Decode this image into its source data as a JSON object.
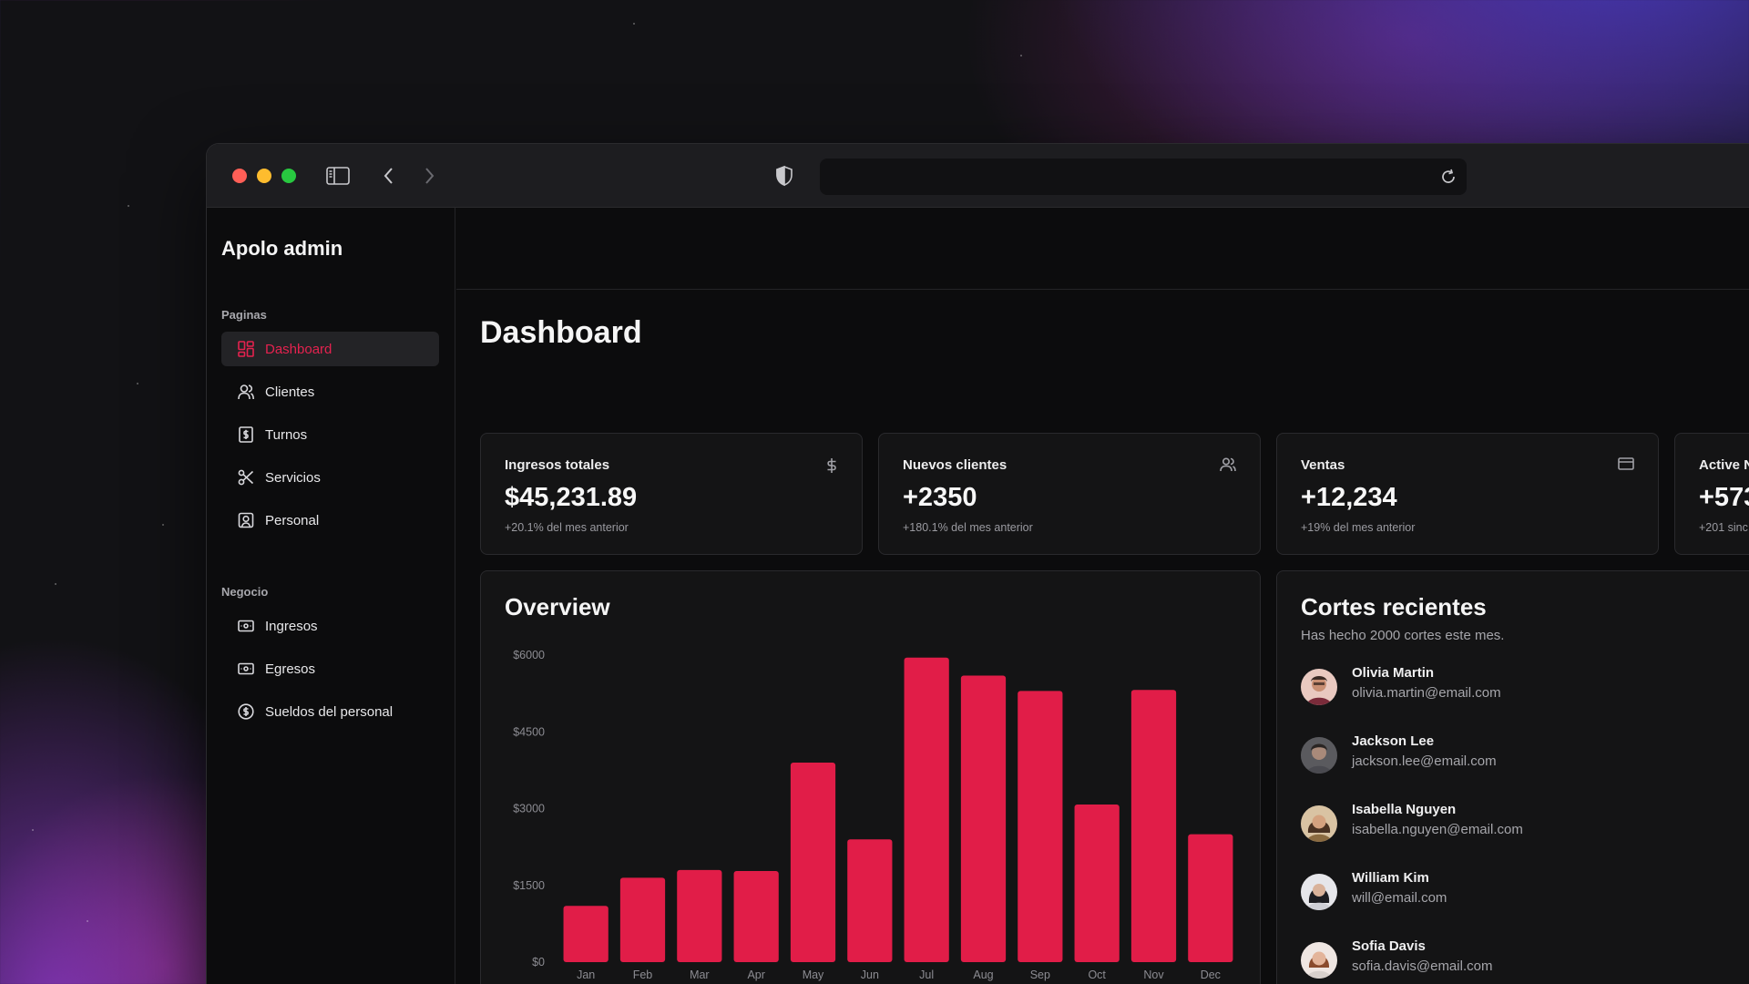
{
  "app": {
    "title": "Apolo admin"
  },
  "sidebar": {
    "sections": [
      {
        "label": "Paginas",
        "items": [
          {
            "label": "Dashboard",
            "icon": "dashboard-icon",
            "active": true
          },
          {
            "label": "Clientes",
            "icon": "users-icon"
          },
          {
            "label": "Turnos",
            "icon": "receipt-icon"
          },
          {
            "label": "Servicios",
            "icon": "scissors-icon"
          },
          {
            "label": "Personal",
            "icon": "contact-icon"
          }
        ]
      },
      {
        "label": "Negocio",
        "items": [
          {
            "label": "Ingresos",
            "icon": "banknote-in-icon"
          },
          {
            "label": "Egresos",
            "icon": "banknote-out-icon"
          },
          {
            "label": "Sueldos del personal",
            "icon": "dollar-circle-icon"
          }
        ]
      }
    ]
  },
  "page": {
    "title": "Dashboard"
  },
  "stats": [
    {
      "label": "Ingresos totales",
      "value": "$45,231.89",
      "sub": "+20.1% del mes anterior",
      "icon": "dollar-icon"
    },
    {
      "label": "Nuevos clientes",
      "value": "+2350",
      "sub": "+180.1% del mes anterior",
      "icon": "users-icon"
    },
    {
      "label": "Ventas",
      "value": "+12,234",
      "sub": "+19% del mes anterior",
      "icon": "credit-card-icon"
    },
    {
      "label": "Active N",
      "value": "+573",
      "sub": "+201 sinc",
      "icon": ""
    }
  ],
  "overview": {
    "title": "Overview"
  },
  "chart_data": {
    "type": "bar",
    "title": "Overview",
    "categories": [
      "Jan",
      "Feb",
      "Mar",
      "Apr",
      "May",
      "Jun",
      "Jul",
      "Aug",
      "Sep",
      "Oct",
      "Nov",
      "Dec"
    ],
    "values": [
      1100,
      1650,
      1800,
      1780,
      3900,
      2400,
      5950,
      5600,
      5300,
      3080,
      5320,
      2500
    ],
    "ylim": [
      0,
      6000
    ],
    "yticks": [
      0,
      1500,
      3000,
      4500,
      6000
    ],
    "ytick_labels": [
      "$0",
      "$1500",
      "$3000",
      "$4500",
      "$6000"
    ],
    "xlabel": "",
    "ylabel": "",
    "grid": false,
    "bar_color": "#e11d48"
  },
  "recent": {
    "title": "Cortes recientes",
    "description": "Has hecho 2000 cortes este mes.",
    "items": [
      {
        "name": "Olivia Martin",
        "email": "olivia.martin@email.com"
      },
      {
        "name": "Jackson Lee",
        "email": "jackson.lee@email.com"
      },
      {
        "name": "Isabella Nguyen",
        "email": "isabella.nguyen@email.com"
      },
      {
        "name": "William Kim",
        "email": "will@email.com"
      },
      {
        "name": "Sofia Davis",
        "email": "sofia.davis@email.com"
      }
    ]
  },
  "colors": {
    "accent": "#e11d48",
    "background": "#0c0c0d",
    "card": "#141415"
  }
}
